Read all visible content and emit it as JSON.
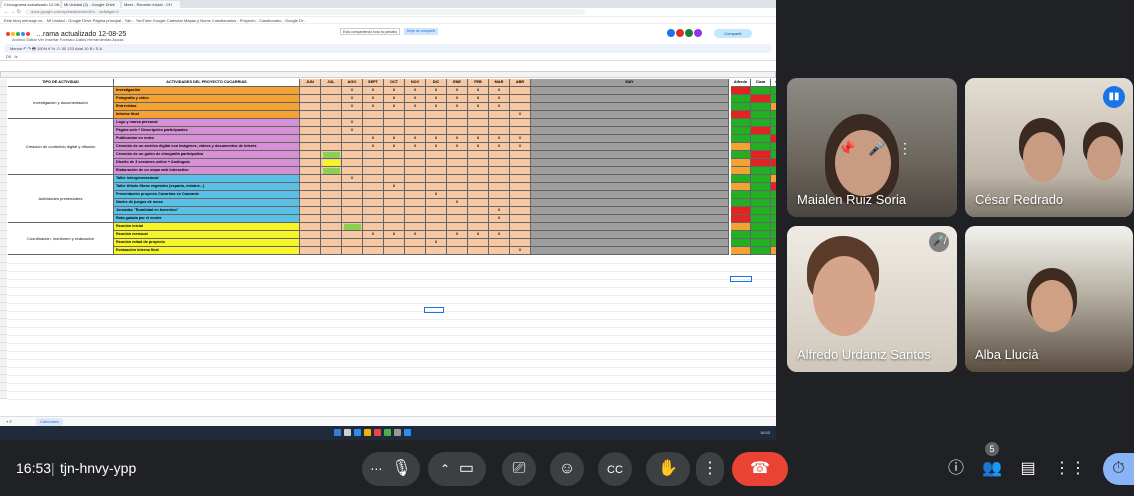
{
  "browser": {
    "tabs": [
      "Cronograma actualizado 12-08...",
      "Mi Unidad (2) - Google Drive",
      "Meet - Reunión inicial - CH"
    ],
    "url": "docs.google.com/spreadsheets/d/1x…/edit#gid=0",
    "bookmarks": "Este bloq mensaje vo... Mi Unidad - Google Drive  Página principal - Yah...  YouTube  Google Calendar  Mapas y Noms  Cuestionarios - Proyecto..  Cuestionario - Google Dr..."
  },
  "sheet": {
    "title": "…rama actualizado 12-08-25",
    "menu": "Archivo  Editar  Ver  Insertar  Formato  Datos  Herramientas  Ayuda",
    "present_chip": "Está compartiendo toda la pantalla",
    "present_stop": "Dejar de compartir",
    "share_label": "Compartir",
    "toolbar": "Menús   ↶  ↷  🖶  100%  €  %  .0  .00  123  Arial  10  B  I  S  A",
    "cell_ref": "D5",
    "formula": "fx",
    "headers": {
      "tipo": "TIPO DE ACTIVIDAD",
      "actividades": "ACTIVIDADES DEL PROYECTO CUCARRIAS",
      "months": [
        "JUN",
        "JUL",
        "AGO",
        "SEPT",
        "OCT",
        "NOV",
        "DIC",
        "ENE",
        "FEB",
        "MAR",
        "ABR",
        "MAY"
      ],
      "people": [
        "Alfredo",
        "Clara",
        "Guille"
      ]
    },
    "categories": [
      {
        "name": "Investigación y documentación",
        "rows": 4,
        "color": "#f4a233"
      },
      {
        "name": "Creación de contenido digital y difusión",
        "rows": 7,
        "color": "#d691d6"
      },
      {
        "name": "Actividades presenciales",
        "rows": 6,
        "color": "#5bc0e6"
      },
      {
        "name": "Coordinación, monitoreo y evaluación",
        "rows": 4,
        "color": "#f5f52a"
      }
    ],
    "activities": [
      "Investigación",
      "Fotografía y vídeo",
      "Entrevistas",
      "Informe final",
      "Logo y marca personal",
      "Página web + Descripción participantes",
      "Publicación en redes",
      "Creación de un archivo digital con imágenes, vídeos y documentos de interés",
      "Creación de un guión de etnografía participativa",
      "Diseño de 3 sesiones online + Audioguía",
      "Elaboración de un mapa web interactivo",
      "Taller intergeneracional",
      "Taller tiñado fibras vegetales (esparto, mimbre...)",
      "Presentación proyecto Cucarrias en Cascante",
      "Noche de juegos de mesa",
      "Jornadas \"Ruralidad en femenino\"",
      "Ruta guiada por el monte",
      "Reunión inicial",
      "Reunión mensual",
      "Reunión mitad de proyecto",
      "Evaluación interna final"
    ],
    "marks": [
      [
        "",
        "",
        "X",
        "X",
        "X",
        "X",
        "X",
        "X",
        "X",
        "X",
        "",
        ""
      ],
      [
        "",
        "",
        "X",
        "X",
        "X",
        "X",
        "X",
        "X",
        "X",
        "X",
        "",
        ""
      ],
      [
        "",
        "",
        "X",
        "X",
        "X",
        "X",
        "X",
        "X",
        "X",
        "X",
        "",
        ""
      ],
      [
        "",
        "",
        "",
        "",
        "",
        "",
        "",
        "",
        "",
        "",
        "X",
        ""
      ],
      [
        "",
        "",
        "X",
        "",
        "",
        "",
        "",
        "",
        "",
        "",
        "",
        ""
      ],
      [
        "",
        "",
        "X",
        "",
        "",
        "",
        "",
        "",
        "",
        "",
        "",
        ""
      ],
      [
        "",
        "",
        "",
        "X",
        "X",
        "X",
        "X",
        "X",
        "X",
        "X",
        "X",
        ""
      ],
      [
        "",
        "",
        "",
        "X",
        "X",
        "X",
        "X",
        "X",
        "X",
        "X",
        "X",
        ""
      ],
      [
        "",
        "X",
        "",
        "",
        "",
        "",
        "",
        "",
        "",
        "",
        "",
        ""
      ],
      [
        "",
        "X",
        "",
        "",
        "",
        "",
        "",
        "",
        "",
        "",
        "",
        ""
      ],
      [
        "",
        "X",
        "",
        "",
        "",
        "",
        "",
        "",
        "",
        "",
        "",
        ""
      ],
      [
        "",
        "",
        "X",
        "",
        "",
        "",
        "",
        "",
        "",
        "",
        "",
        ""
      ],
      [
        "",
        "",
        "",
        "",
        "X",
        "",
        "",
        "",
        "",
        "",
        "",
        ""
      ],
      [
        "",
        "",
        "",
        "",
        "",
        "",
        "X",
        "",
        "",
        "",
        "",
        ""
      ],
      [
        "",
        "",
        "",
        "",
        "",
        "",
        "",
        "X",
        "",
        "",
        "",
        ""
      ],
      [
        "",
        "",
        "",
        "",
        "",
        "",
        "",
        "",
        "",
        "X",
        "",
        ""
      ],
      [
        "",
        "",
        "",
        "",
        "",
        "",
        "",
        "",
        "",
        "X",
        "",
        ""
      ],
      [
        "",
        "",
        "X",
        "",
        "",
        "",
        "",
        "",
        "",
        "",
        "",
        ""
      ],
      [
        "",
        "",
        "",
        "X",
        "X",
        "X",
        "",
        "X",
        "X",
        "X",
        "",
        ""
      ],
      [
        "",
        "",
        "",
        "",
        "",
        "",
        "X",
        "",
        "",
        "",
        "",
        ""
      ],
      [
        "",
        "",
        "",
        "",
        "",
        "",
        "",
        "",
        "",
        "",
        "X",
        ""
      ]
    ],
    "highlight_cells": [
      [
        8,
        1,
        "#8bd14d"
      ],
      [
        9,
        1,
        "#f5f52a"
      ],
      [
        10,
        1,
        "#8bd14d"
      ],
      [
        17,
        2,
        "#8bd14d"
      ]
    ],
    "people_status": [
      [
        "#e32222",
        "#22b022",
        "#22b022"
      ],
      [
        "#22b022",
        "#e32222",
        "#22b022"
      ],
      [
        "#22b022",
        "#22b022",
        "#f4a233"
      ],
      [
        "#e32222",
        "#22b022",
        "#22b022"
      ],
      [
        "#22b022",
        "#22b022",
        "#22b022"
      ],
      [
        "#22b022",
        "#e32222",
        "#22b022"
      ],
      [
        "#22b022",
        "#22b022",
        "#e32222"
      ],
      [
        "#f4a233",
        "#22b022",
        "#22b022"
      ],
      [
        "#22b022",
        "#e32222",
        "#22b022"
      ],
      [
        "#f4a233",
        "#e32222",
        "#e32222"
      ],
      [
        "#f4a233",
        "#22b022",
        "#22b022"
      ],
      [
        "#22b022",
        "#22b022",
        "#f4a233"
      ],
      [
        "#f4a233",
        "#22b022",
        "#e32222"
      ],
      [
        "#22b022",
        "#22b022",
        "#22b022"
      ],
      [
        "#22b022",
        "#22b022",
        "#22b022"
      ],
      [
        "#e32222",
        "#22b022",
        "#22b022"
      ],
      [
        "#e32222",
        "#22b022",
        "#22b022"
      ],
      [
        "#f4a233",
        "#22b022",
        "#22b022"
      ],
      [
        "#22b022",
        "#22b022",
        "#22b022"
      ],
      [
        "#22b022",
        "#22b022",
        "#22b022"
      ],
      [
        "#f4a233",
        "#22b022",
        "#f4a233"
      ]
    ],
    "sheet_tab": "Calendario",
    "tray_time": "16:53"
  },
  "participants": [
    {
      "name": "Maialen Ruiz Soria"
    },
    {
      "name": "César Redrado"
    },
    {
      "name": "Alfredo Urdaniz Santos"
    },
    {
      "name": "Alba Llucià"
    }
  ],
  "meet": {
    "time": "16:53",
    "separator": "|",
    "code": "tjn-hnvy-ypp",
    "participant_count": "5"
  },
  "colors": {
    "month_fill": "#f6c9a4",
    "grey_fill": "#9e9e9e",
    "end_call": "#ea4335",
    "accent": "#8ab4f8"
  }
}
